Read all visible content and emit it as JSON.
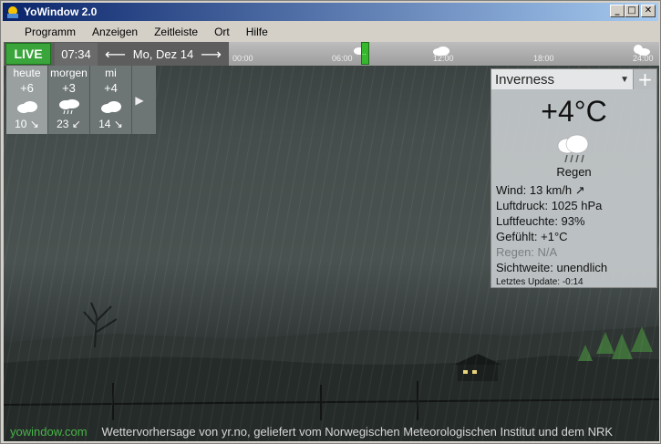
{
  "window": {
    "title": "YoWindow 2.0"
  },
  "menu": {
    "items": [
      "Programm",
      "Anzeigen",
      "Zeitleiste",
      "Ort",
      "Hilfe"
    ]
  },
  "timeline": {
    "live_label": "LIVE",
    "current_time": "07:34",
    "date": "Mo, Dez 14",
    "ticks": [
      "00:00",
      "06:00",
      "12:00",
      "18:00",
      "24:00"
    ],
    "marker_label": "..",
    "icons": [
      "cloud-icon",
      "sun-cloud-icon"
    ]
  },
  "forecast": {
    "days": [
      {
        "label": "heute",
        "temp": "+6",
        "icon": "cloud-icon",
        "wind": "10 ↘"
      },
      {
        "label": "morgen",
        "temp": "+3",
        "icon": "rain-cloud-icon",
        "wind": "23 ↙"
      },
      {
        "label": "mi",
        "temp": "+4",
        "icon": "cloud-icon",
        "wind": "14 ↘"
      }
    ],
    "next_label": "▶"
  },
  "panel": {
    "location": "Inverness",
    "add_label": "+",
    "temperature": "+4°C",
    "condition": "Regen",
    "wind": "Wind:  13 km/h ↗",
    "pressure": "Luftdruck:  1025 hPa",
    "humidity": "Luftfeuchte:  93%",
    "feels": "Gefühlt:   +1°C",
    "rain": "Regen:  N/A",
    "visibility": "Sichtweite:  unendlich",
    "updated": "Letztes Update:  -0:14"
  },
  "footer": {
    "site": "yowindow.com",
    "credit": "Wettervorhersage von yr.no, geliefert vom Norwegischen Meteorologischen Institut und dem NRK"
  },
  "colors": {
    "live_green": "#3aa53a",
    "site_green": "#48b348",
    "title_blue": "#0a246a"
  }
}
